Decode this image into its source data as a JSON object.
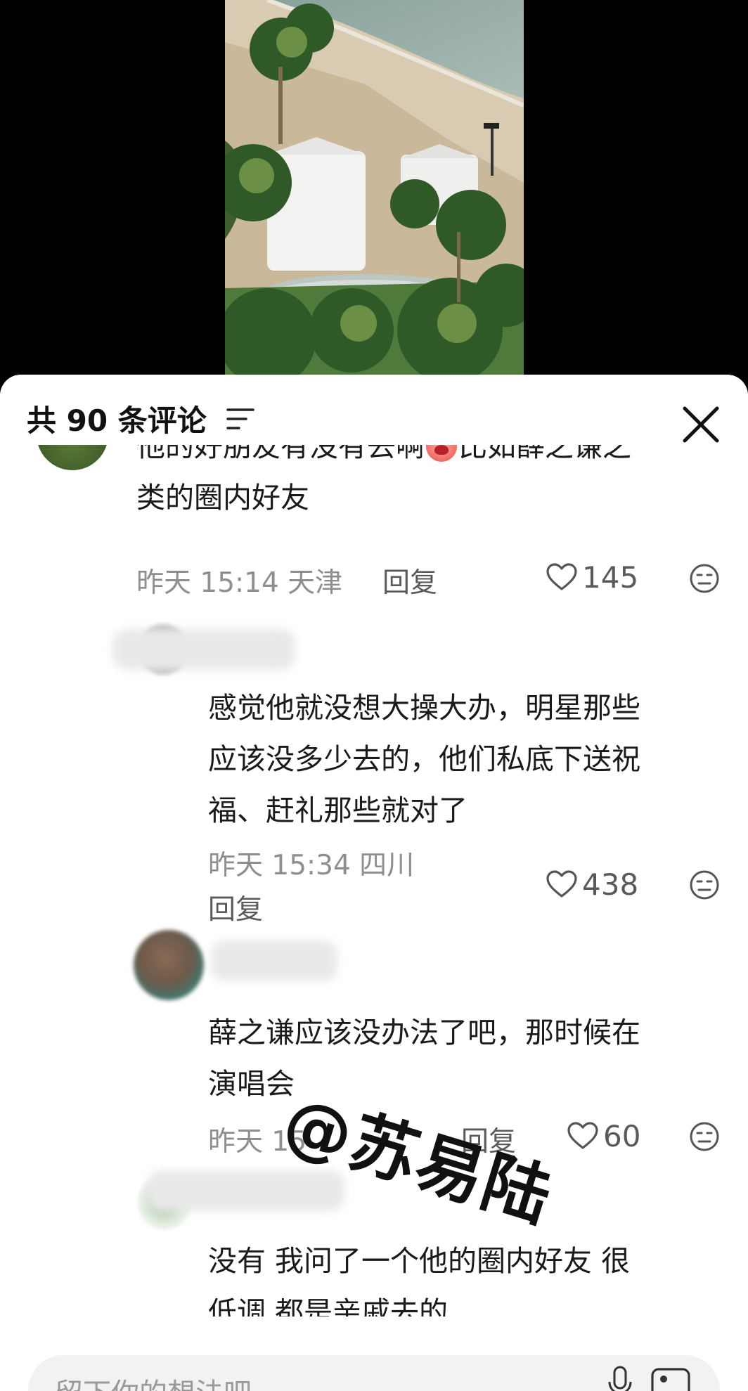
{
  "header": {
    "comment_count_label": "共 90 条评论"
  },
  "comments": [
    {
      "text_lines": [
        "他的好朋友有没有去啊",
        "比如薛之谦之",
        "类的圈内好友"
      ],
      "time": "昨天 15:14 天津",
      "reply_label": "回复",
      "likes": "145"
    },
    {
      "text_lines": [
        "感觉他就没想大操大办，明星那些",
        "应该没多少去的，他们私底下送祝",
        "福、赶礼那些就对了"
      ],
      "time": "昨天 15:34 四川",
      "reply_label": "回复",
      "likes": "438"
    },
    {
      "text_lines": [
        "薛之谦应该没办法了吧，那时候在",
        "演唱会"
      ],
      "time": "昨天 15",
      "reply_label": "回复",
      "likes": "60"
    },
    {
      "text_lines": [
        "没有 我问了一个他的圈内好友 很",
        "低调 都是亲戚去的"
      ]
    }
  ],
  "watermark": "@苏易陆",
  "input": {
    "placeholder": "留下你的想法吧"
  },
  "icons": {
    "sort": "sort-icon",
    "close": "close-icon",
    "like": "heart-icon",
    "dislike": "dislike-face-icon",
    "mic": "mic-icon",
    "image": "image-icon"
  }
}
